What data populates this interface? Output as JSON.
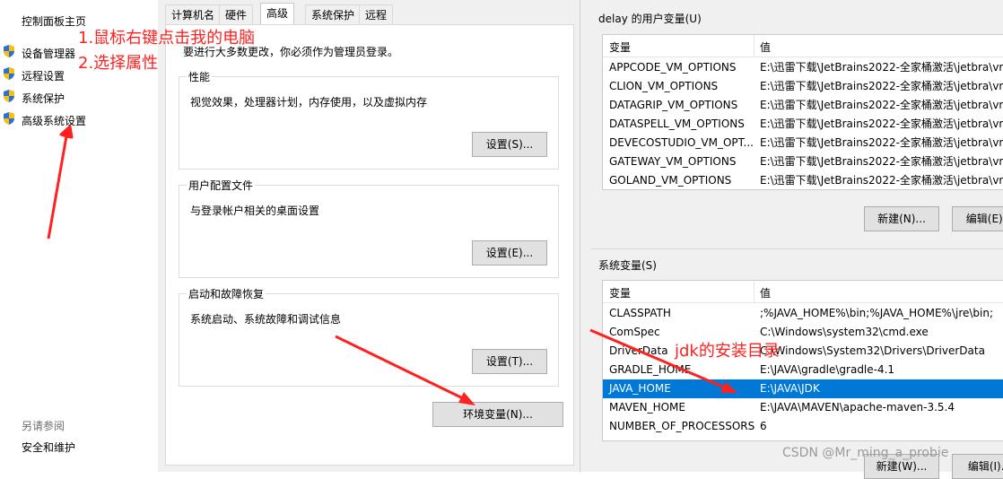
{
  "left_panel": {
    "home": "控制面板主页",
    "items": [
      {
        "label": "设备管理器"
      },
      {
        "label": "远程设置"
      },
      {
        "label": "系统保护"
      },
      {
        "label": "高级系统设置"
      }
    ],
    "see_also": "另请参阅",
    "security": "安全和维护"
  },
  "sysprops": {
    "tabs": [
      "计算机名",
      "硬件",
      "高级",
      "系统保护",
      "远程"
    ],
    "active_tab": "高级",
    "admin_note": "要进行大多数更改，你必须作为管理员登录。",
    "performance": {
      "title": "性能",
      "desc": "视觉效果，处理器计划，内存使用，以及虚拟内存",
      "button": "设置(S)..."
    },
    "profile": {
      "title": "用户配置文件",
      "desc": "与登录帐户相关的桌面设置",
      "button": "设置(E)..."
    },
    "startup": {
      "title": "启动和故障恢复",
      "desc": "系统启动、系统故障和调试信息",
      "button": "设置(T)..."
    },
    "env_button": "环境变量(N)..."
  },
  "envvars": {
    "user_title": "delay 的用户变量(U)",
    "col_var": "变量",
    "col_val": "值",
    "user_rows": [
      {
        "name": "APPCODE_VM_OPTIONS",
        "value": "E:\\迅雷下载\\JetBrains2022-全家桶激活\\jetbra\\vm"
      },
      {
        "name": "CLION_VM_OPTIONS",
        "value": "E:\\迅雷下载\\JetBrains2022-全家桶激活\\jetbra\\vm"
      },
      {
        "name": "DATAGRIP_VM_OPTIONS",
        "value": "E:\\迅雷下载\\JetBrains2022-全家桶激活\\jetbra\\vm"
      },
      {
        "name": "DATASPELL_VM_OPTIONS",
        "value": "E:\\迅雷下载\\JetBrains2022-全家桶激活\\jetbra\\vm"
      },
      {
        "name": "DEVECOSTUDIO_VM_OPT...",
        "value": "E:\\迅雷下载\\JetBrains2022-全家桶激活\\jetbra\\vm"
      },
      {
        "name": "GATEWAY_VM_OPTIONS",
        "value": "E:\\迅雷下载\\JetBrains2022-全家桶激活\\jetbra\\vm"
      },
      {
        "name": "GOLAND_VM_OPTIONS",
        "value": "E:\\迅雷下载\\JetBrains2022-全家桶激活\\jetbra\\vm"
      }
    ],
    "user_new": "新建(N)...",
    "user_edit": "编辑(E)...",
    "sys_title": "系统变量(S)",
    "sys_rows": [
      {
        "name": "CLASSPATH",
        "value": ";%JAVA_HOME%\\bin;%JAVA_HOME%\\jre\\bin;"
      },
      {
        "name": "ComSpec",
        "value": "C:\\Windows\\system32\\cmd.exe"
      },
      {
        "name": "DriverData",
        "value": "C:\\Windows\\System32\\Drivers\\DriverData"
      },
      {
        "name": "GRADLE_HOME",
        "value": "E:\\JAVA\\gradle\\gradle-4.1"
      },
      {
        "name": "JAVA_HOME",
        "value": "E:\\JAVA\\JDK"
      },
      {
        "name": "MAVEN_HOME",
        "value": "E:\\JAVA\\MAVEN\\apache-maven-3.5.4"
      },
      {
        "name": "NUMBER_OF_PROCESSORS",
        "value": "6"
      }
    ],
    "selected_sys_row": "JAVA_HOME",
    "sys_new": "新建(W)...",
    "sys_edit": "编辑(I)..."
  },
  "annotations": {
    "step1": "1.鼠标右键点击我的电脑",
    "step2": "2.选择属性",
    "jdk": "jdk的安装目录",
    "color": "#ff2020"
  },
  "watermark": "CSDN @Mr_ming_a_probie",
  "colors": {
    "selection": "#0078d7",
    "dialog_bg": "#f0f0f0"
  },
  "icons": [
    "shield-icon"
  ]
}
